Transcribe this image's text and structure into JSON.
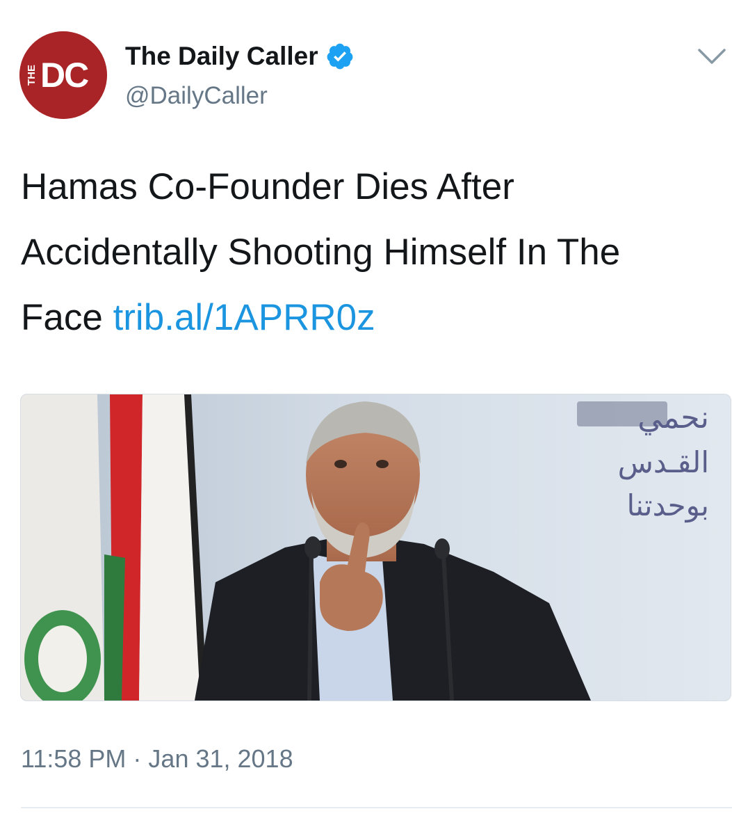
{
  "author": {
    "display_name": "The Daily Caller",
    "handle": "@DailyCaller",
    "verified": true,
    "avatar_logo_small": "THE",
    "avatar_logo_large": "DC",
    "avatar_color": "#a92427"
  },
  "tweet": {
    "text": "Hamas Co-Founder Dies After Accidentally Shooting Himself In The Face ",
    "link_text": "trib.al/1APRR0z",
    "link_color": "#1b95e0"
  },
  "media": {
    "banner_text_line1": "نحمي",
    "banner_text_line2": "القـدس",
    "banner_text_line3": "بوحدتنا"
  },
  "timestamp": {
    "time": "11:58 PM",
    "separator": " · ",
    "date": "Jan 31, 2018"
  },
  "icons": {
    "verified": "verified-badge-icon",
    "caret": "chevron-down-icon"
  }
}
